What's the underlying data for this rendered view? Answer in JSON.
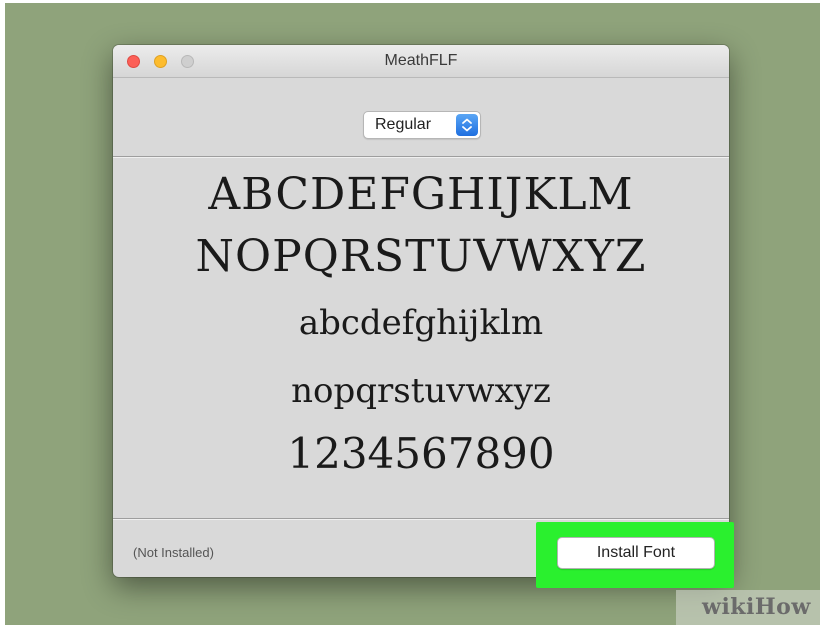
{
  "window": {
    "title": "MeathFLF"
  },
  "style_selector": {
    "selected": "Regular",
    "icon": "chevron-up-down-icon",
    "accent_color": "#2f7ce6"
  },
  "preview": {
    "uppercase_1": "ABCDEFGHIJKLM",
    "uppercase_2": "NOPQRSTUVWXYZ",
    "lowercase_1": "abcdefghijklm",
    "lowercase_2": "nopqrstuvwxyz",
    "digits": "1234567890"
  },
  "footer": {
    "status": "(Not Installed)",
    "install_button": "Install Font",
    "highlight_color": "#2af02e"
  },
  "watermark": {
    "text": "wikiHow"
  }
}
